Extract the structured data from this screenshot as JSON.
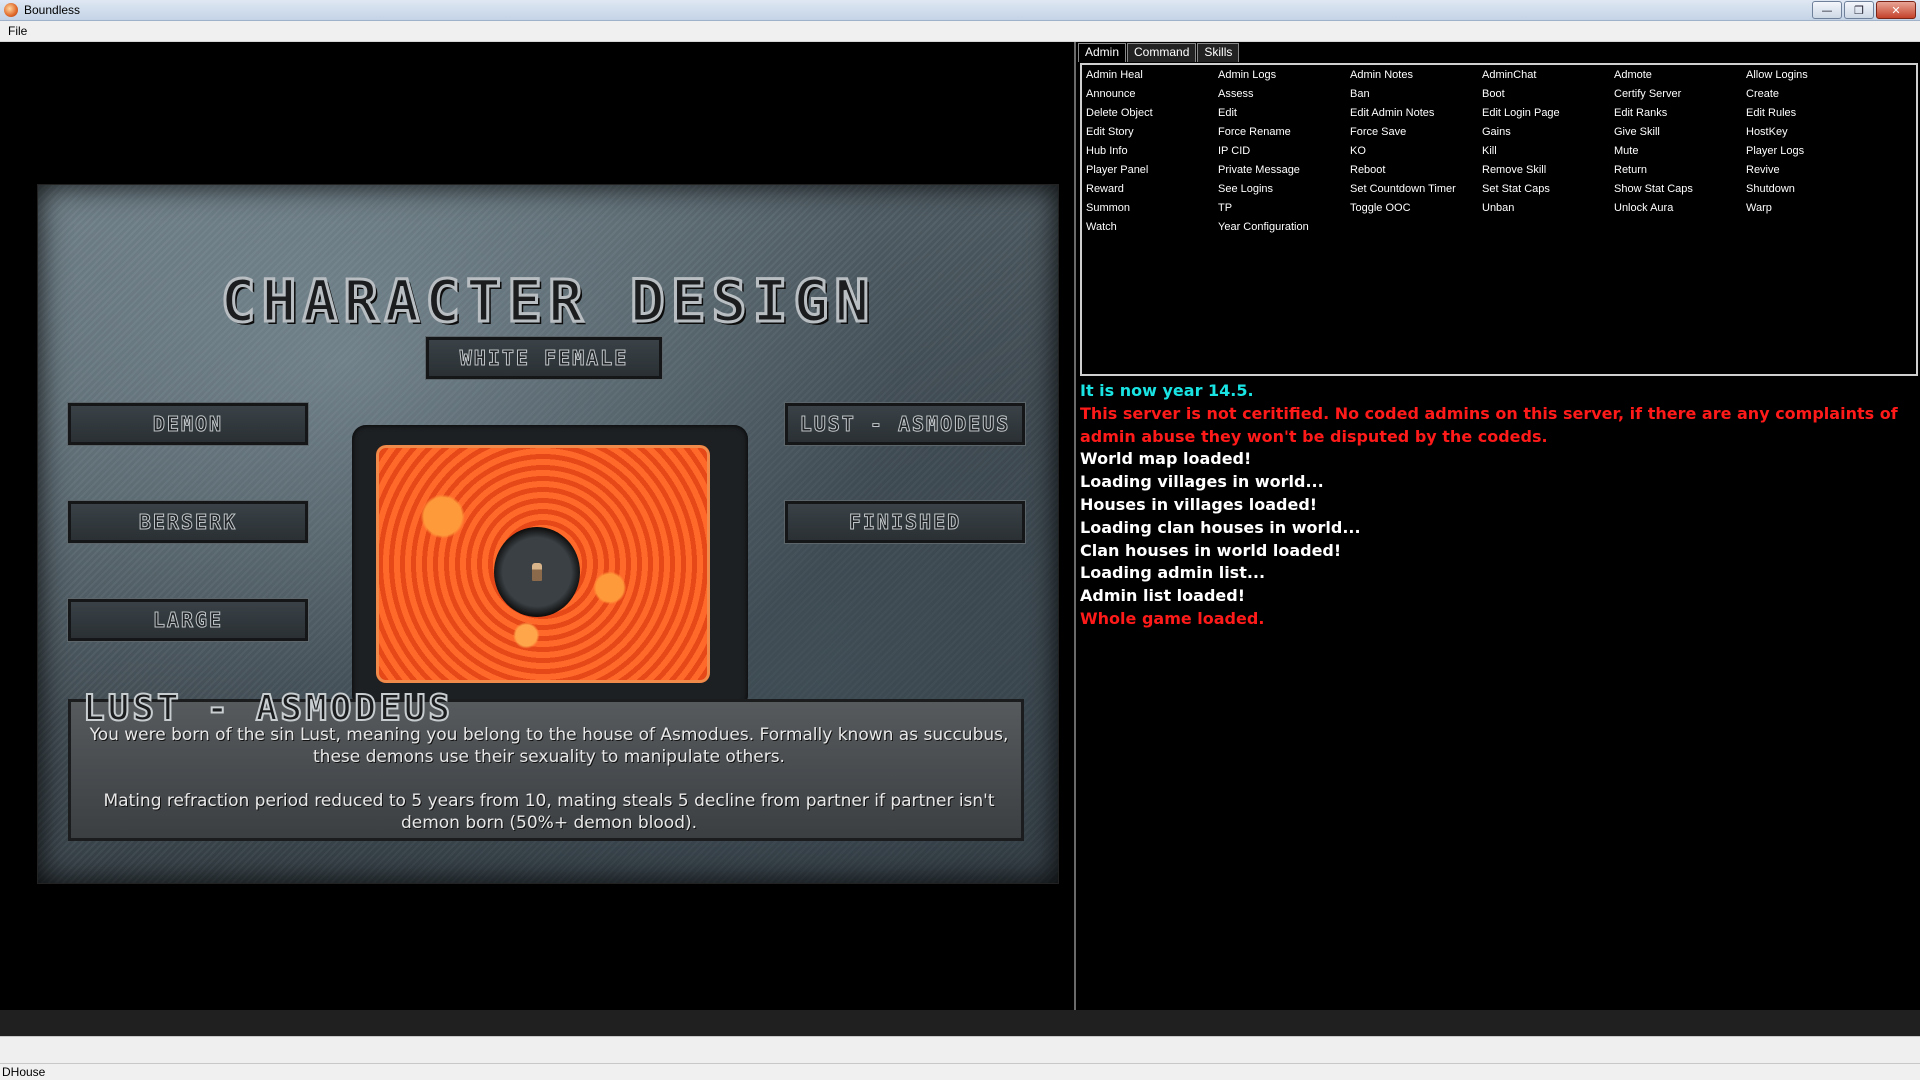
{
  "window": {
    "title": "Boundless",
    "controls": [
      "—",
      "❐",
      "✕"
    ]
  },
  "menubar": {
    "file": "File"
  },
  "design": {
    "title": "CHARACTER DESIGN",
    "race": "WHITE FEMALE",
    "species": "DEMON",
    "class": "BERSERK",
    "size": "LARGE",
    "sin": "LUST - ASMODEUS",
    "finished": "FINISHED",
    "sin_title": "LUST - ASMODEUS",
    "sin_description": "You were born of the sin Lust, meaning you belong to the house of Asmodues. Formally known as succubus, these demons use their sexuality to manipulate others.",
    "sin_effect": "Mating refraction period reduced to 5 years from 10, mating steals 5 decline from partner if partner isn't demon born (50%+ demon blood)."
  },
  "tabs": [
    "Admin",
    "Command",
    "Skills"
  ],
  "verbs": [
    "Admin Heal",
    "Admin Logs",
    "Admin Notes",
    "AdminChat",
    "Admote",
    "Allow Logins",
    "Announce",
    "Assess",
    "Ban",
    "Boot",
    "Certify Server",
    "Create",
    "Delete Object",
    "Edit",
    "Edit Admin Notes",
    "Edit Login Page",
    "Edit Ranks",
    "Edit Rules",
    "Edit Story",
    "Force Rename",
    "Force Save",
    "Gains",
    "Give Skill",
    "HostKey",
    "Hub Info",
    "IP CID",
    "KO",
    "Kill",
    "Mute",
    "Player Logs",
    "Player Panel",
    "Private Message",
    "Reboot",
    "Remove Skill",
    "Return",
    "Revive",
    "Reward",
    "See Logins",
    "Set Countdown Timer",
    "Set Stat Caps",
    "Show Stat Caps",
    "Shutdown",
    "Summon",
    "TP",
    "Toggle OOC",
    "Unban",
    "Unlock Aura",
    "Warp",
    "Watch",
    "Year Configuration"
  ],
  "output": [
    {
      "text": "It is now year 14.5.",
      "color": "#19e3e3"
    },
    {
      "text": "This server is not ceritified. No coded admins on this server, if there are any complaints of admin abuse they won't be disputed by the codeds.",
      "color": "#ff1a1a"
    },
    {
      "text": "World map loaded!",
      "color": "#ffffff"
    },
    {
      "text": "Loading villages in world...",
      "color": "#ffffff"
    },
    {
      "text": "Houses in villages loaded!",
      "color": "#ffffff"
    },
    {
      "text": "Loading clan houses in world...",
      "color": "#ffffff"
    },
    {
      "text": "Clan houses in world loaded!",
      "color": "#ffffff"
    },
    {
      "text": "Loading admin list...",
      "color": "#ffffff"
    },
    {
      "text": "Admin list loaded!",
      "color": "#ffffff"
    },
    {
      "text": "Whole game loaded.",
      "color": "#ff1a1a"
    }
  ],
  "status": {
    "text": "DHouse"
  }
}
